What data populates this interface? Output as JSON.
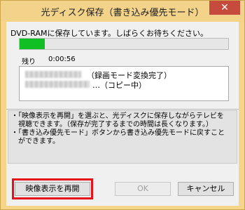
{
  "window": {
    "title": "光ディスク保存（書き込み優先モード）",
    "close_glyph": "✕"
  },
  "status_message": "DVD-RAMに保存しています。しばらくお待ちください。",
  "progress": {
    "fraction": 0.12,
    "fill_color": "#0fbf24"
  },
  "remaining": {
    "label": "残り",
    "time": "0:00:56"
  },
  "queue": [
    {
      "status": "（録画モード変換完了）"
    },
    {
      "status": "…（コピー中）"
    }
  ],
  "info_lines": [
    "・「映像表示を再開」を選ぶと、光ディスクに保存しながらテレビを",
    "　視聴できます。（保存が完了するまでの時間は長くなります。）",
    "・「書き込み優先モード」ボタンから書き込み優先モードに戻すこと",
    "　ができます。"
  ],
  "buttons": {
    "resume": "映像表示を再開",
    "ok": "OK",
    "cancel": "キャンセル"
  },
  "highlight_color": "#e6101a"
}
